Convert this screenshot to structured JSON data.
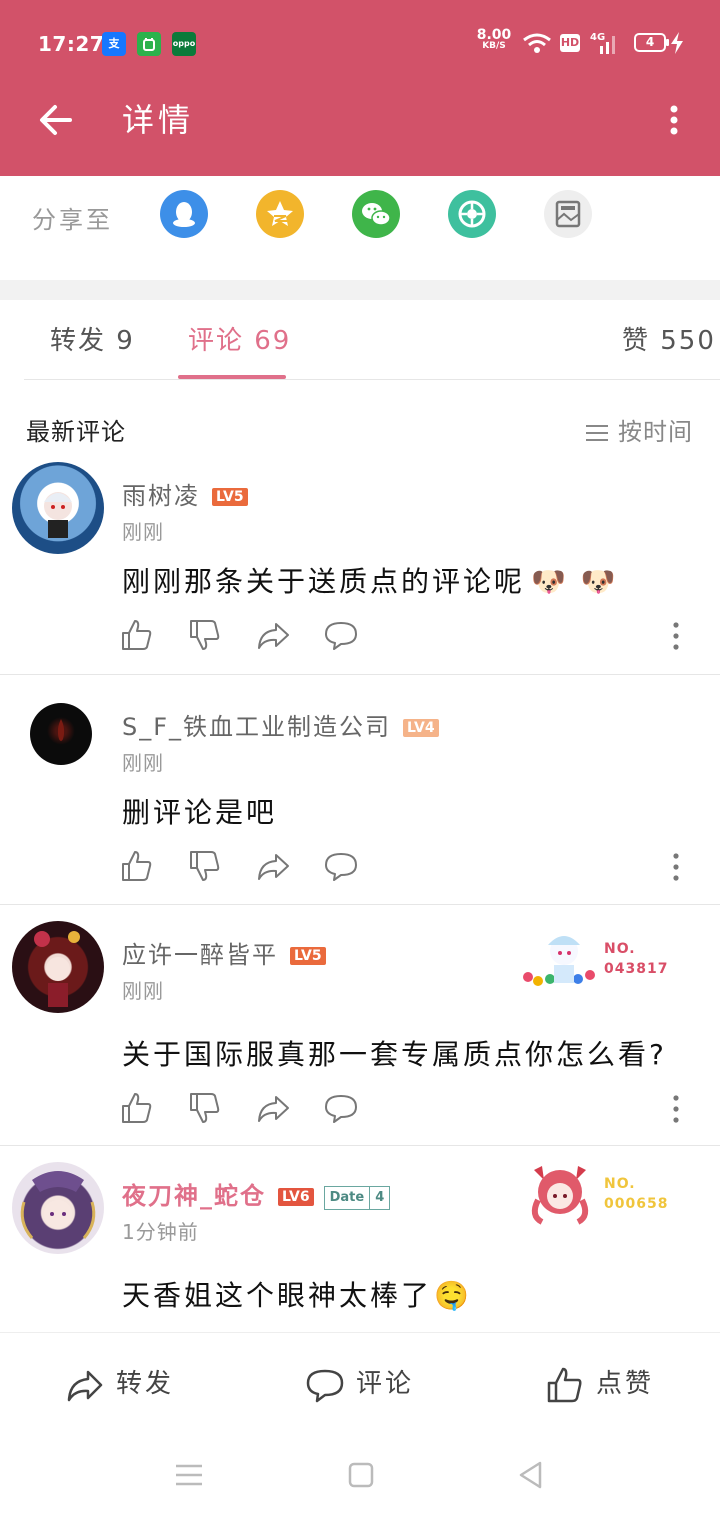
{
  "status_bar": {
    "time": "17:27",
    "app_icons": [
      "支",
      "",
      "oppo"
    ],
    "net_speed_value": "8.00",
    "net_speed_unit": "KB/S",
    "hd": "HD",
    "signal": "4G",
    "battery": "4"
  },
  "appbar": {
    "title": "详情"
  },
  "share": {
    "label": "分享至",
    "targets": [
      "qq-icon",
      "qzone-icon",
      "wechat-icon",
      "moments-icon",
      "gallery-icon"
    ]
  },
  "tabs": [
    {
      "label": "转发 9"
    },
    {
      "label": "评论 69"
    },
    {
      "label": "赞 550"
    }
  ],
  "section": {
    "title": "最新评论",
    "sort_label": "按时间"
  },
  "comments": [
    {
      "user": "雨树凌",
      "level": "LV5",
      "time": "刚刚",
      "text": "刚刚那条关于送质点的评论呢",
      "emoji": "🐶 🐶"
    },
    {
      "user": "S_F_铁血工业制造公司",
      "level": "LV4",
      "time": "刚刚",
      "text": "删评论是吧"
    },
    {
      "user": "应许一醉皆平",
      "level": "LV5",
      "time": "刚刚",
      "text": "关于国际服真那一套专属质点你怎么看?",
      "badge_label": "NO.",
      "badge_number": "043817"
    },
    {
      "user": "夜刀神_蛇仓",
      "level": "LV6",
      "date_badge": "Date",
      "date_level": "4",
      "time": "1分钟前",
      "text": "天香姐这个眼神太棒了",
      "emoji": "🤤",
      "badge_label": "NO.",
      "badge_number": "000658"
    }
  ],
  "bottom_bar": {
    "repost": "转发",
    "comment": "评论",
    "like": "点赞"
  },
  "colors": {
    "brand": "#d25269",
    "accent": "#e0708a",
    "lv5": "#ea6a3c",
    "lv4": "#f5b389",
    "lv6": "#e3553f"
  }
}
